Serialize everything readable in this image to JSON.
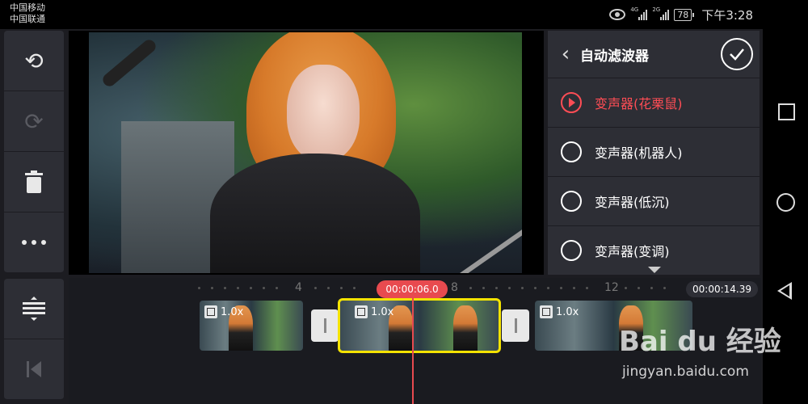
{
  "status_bar": {
    "carrier1": "中国移动",
    "carrier2": "中国联通",
    "net1": "4G",
    "net2": "2G",
    "battery": "78",
    "time": "下午3:28"
  },
  "toolbar": {
    "undo_icon": "undo-icon",
    "redo_icon": "redo-icon",
    "delete_icon": "trash-icon",
    "more_icon": "more-icon",
    "adjust_icon": "adjust-layers-icon",
    "skip_start_icon": "skip-to-start-icon"
  },
  "filter_panel": {
    "title": "自动滤波器",
    "options": [
      {
        "label": "变声器(花栗鼠)",
        "selected": true
      },
      {
        "label": "变声器(机器人)",
        "selected": false
      },
      {
        "label": "变声器(低沉)",
        "selected": false
      },
      {
        "label": "变声器(变调)",
        "selected": false
      }
    ]
  },
  "timeline": {
    "current_time": "00:00:06.0",
    "total_time": "00:00:14.39",
    "ticks": [
      "4",
      "8",
      "12"
    ],
    "clips": [
      {
        "speed": "1.0x"
      },
      {
        "speed": "1.0x"
      },
      {
        "speed": "1.0x"
      }
    ]
  },
  "watermark": {
    "logo": "Bai du 经验",
    "url": "jingyan.baidu.com"
  },
  "colors": {
    "accent": "#e84a4f",
    "selected_clip": "#f4e300",
    "panel": "#2d2e35"
  }
}
